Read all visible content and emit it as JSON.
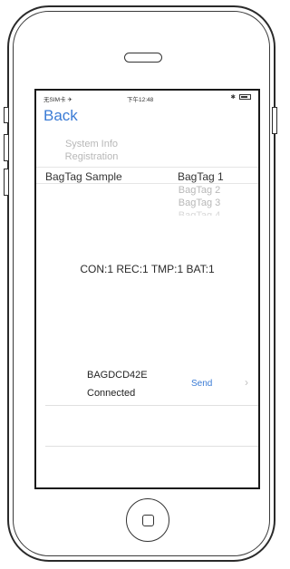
{
  "statusbar": {
    "carrier": "无SIM卡 ✈",
    "time": "下午12:48",
    "bluetooth": "✱"
  },
  "nav": {
    "back_label": "Back"
  },
  "picker": {
    "left_items_above": [
      "System Info",
      "Registration"
    ],
    "left_selected": "BagTag Sample",
    "right_selected": "BagTag 1",
    "right_items_below": [
      "BagTag 2",
      "BagTag 3",
      "BagTag 4"
    ]
  },
  "summary": {
    "text": "CON:1 REC:1 TMP:1 BAT:1"
  },
  "device": {
    "id": "BAGDCD42E",
    "status": "Connected",
    "send_label": "Send",
    "chevron": "›"
  },
  "icons": {
    "bluetooth": "bluetooth-icon",
    "battery": "battery-icon",
    "wifi": "wifi-icon"
  }
}
